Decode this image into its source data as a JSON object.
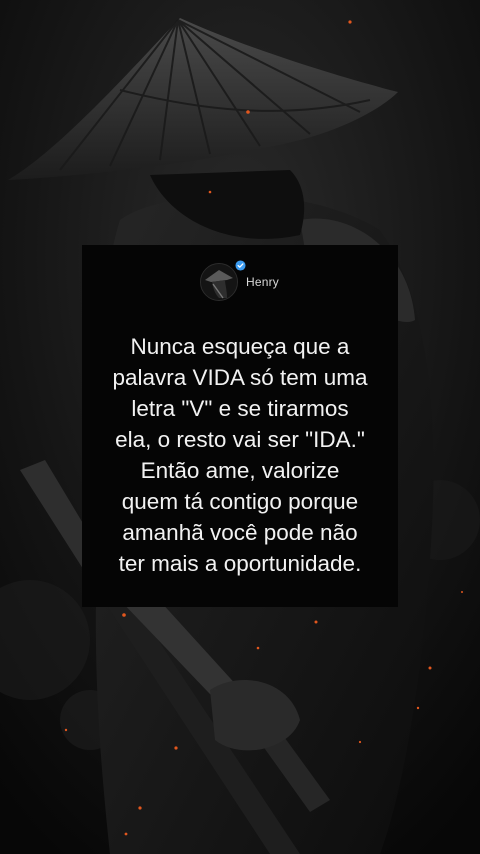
{
  "post": {
    "username": "Henry",
    "verified": true,
    "quote_lines": [
      "Nunca esqueça que a",
      "palavra VIDA só tem uma",
      "letra \"V\" e se tirarmos",
      "ela, o resto vai ser \"IDA.\"",
      "Então ame, valorize",
      "quem tá contigo porque",
      "amanhã você pode não",
      "ter mais a oportunidade."
    ]
  },
  "background": {
    "subject": "samurai-with-straw-hat-and-katana",
    "ember_color": "#e2571e"
  },
  "colors": {
    "card": "#050505",
    "text": "#f2f2f2",
    "verified_badge": "#3b9bf0"
  }
}
